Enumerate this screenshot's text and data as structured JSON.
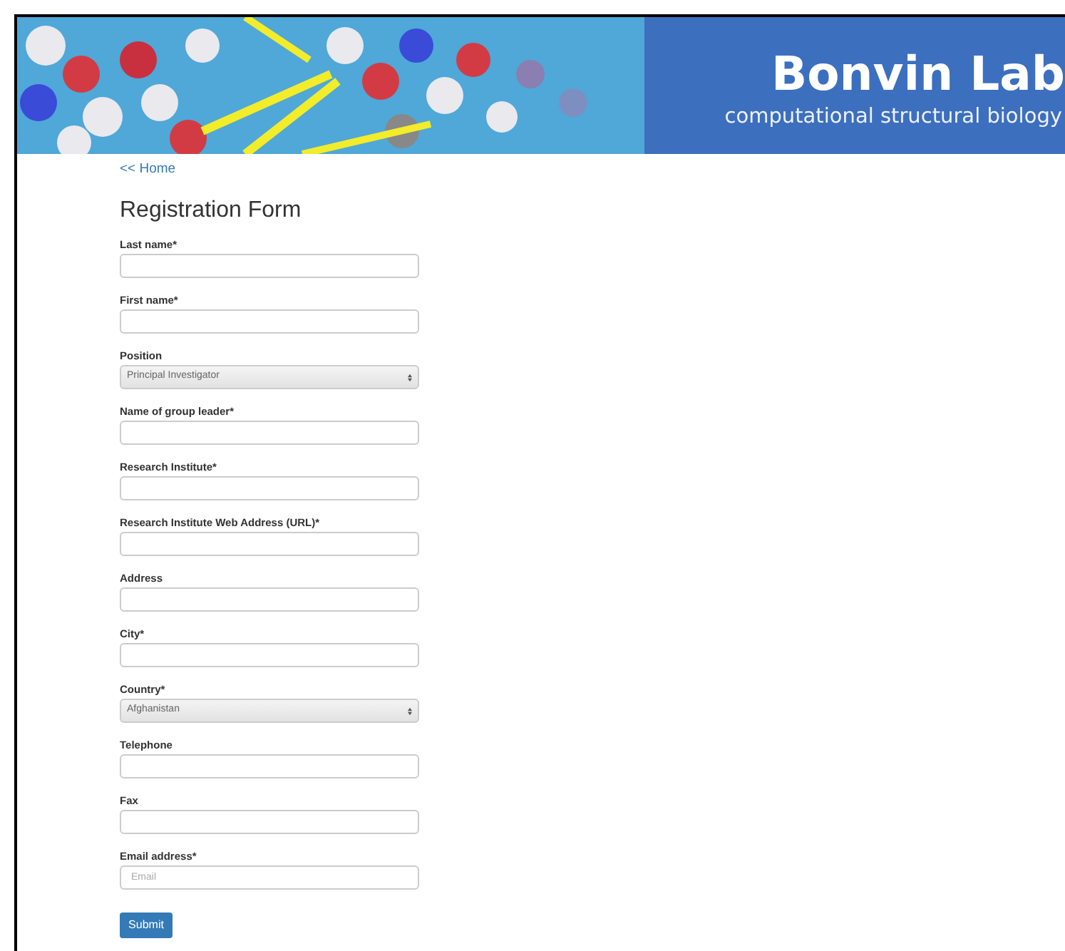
{
  "banner": {
    "title": "Bonvin Lab",
    "subtitle": "computational structural biology"
  },
  "home_link": "<< Home",
  "heading": "Registration Form",
  "fields": [
    {
      "kind": "text",
      "label": "Last name*"
    },
    {
      "kind": "text",
      "label": "First name*"
    },
    {
      "kind": "select",
      "label": "Position",
      "value": "Principal Investigator"
    },
    {
      "kind": "text",
      "label": "Name of group leader*"
    },
    {
      "kind": "text",
      "label": "Research Institute*"
    },
    {
      "kind": "text",
      "label": "Research Institute Web Address (URL)*"
    },
    {
      "kind": "text",
      "label": "Address"
    },
    {
      "kind": "text",
      "label": "City*"
    },
    {
      "kind": "select",
      "label": "Country*",
      "value": "Afghanistan"
    },
    {
      "kind": "text",
      "label": "Telephone"
    },
    {
      "kind": "text",
      "label": "Fax"
    },
    {
      "kind": "email",
      "label": "Email address*",
      "placeholder": "Email"
    }
  ],
  "submit": "Submit"
}
